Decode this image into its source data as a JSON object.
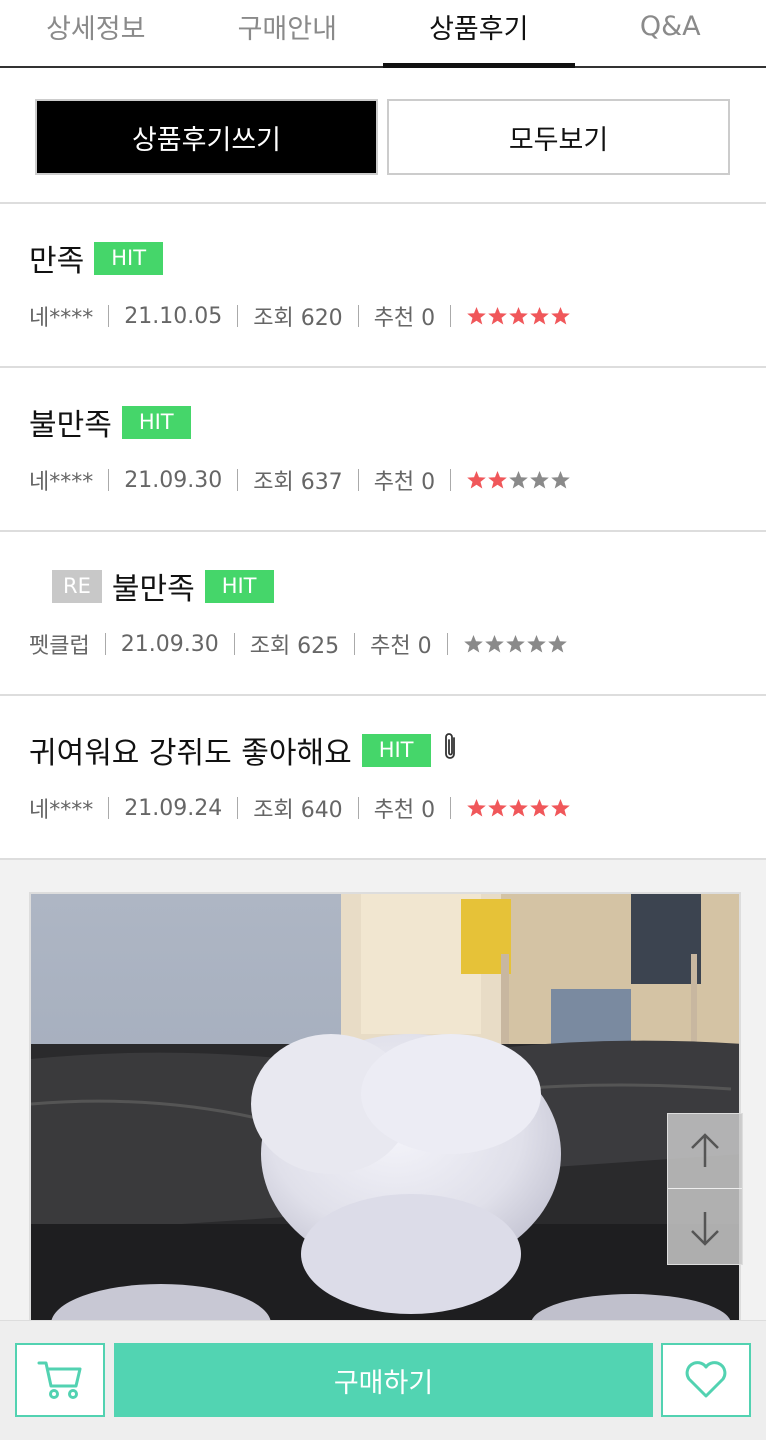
{
  "tabs": [
    {
      "label": "상세정보",
      "active": false
    },
    {
      "label": "구매안내",
      "active": false
    },
    {
      "label": "상품후기",
      "active": true
    },
    {
      "label": "Q&A",
      "active": false
    }
  ],
  "actions": {
    "write_label": "상품후기쓰기",
    "all_label": "모두보기"
  },
  "reviews": [
    {
      "title": "만족",
      "badge": "HIT",
      "author": "네****",
      "date": "21.10.05",
      "views": "조회 620",
      "recommend": "추천 0",
      "rating": 5,
      "is_reply": false,
      "has_attachment": false
    },
    {
      "title": "불만족",
      "badge": "HIT",
      "author": "네****",
      "date": "21.09.30",
      "views": "조회 637",
      "recommend": "추천 0",
      "rating": 2,
      "is_reply": false,
      "has_attachment": false
    },
    {
      "title": "불만족",
      "badge": "HIT",
      "reply_badge": "RE",
      "author": "펫클럽",
      "date": "21.09.30",
      "views": "조회 625",
      "recommend": "추천 0",
      "rating": 0,
      "is_reply": true,
      "has_attachment": false
    },
    {
      "title": "귀여워요 강쥐도 좋아해요",
      "badge": "HIT",
      "author": "네****",
      "date": "21.09.24",
      "views": "조회 640",
      "recommend": "추천 0",
      "rating": 5,
      "is_reply": false,
      "has_attachment": true
    }
  ],
  "colors": {
    "star_on": "#f0575a",
    "star_off": "#8a8a8a",
    "hit": "#45d66a",
    "accent": "#52d4b2"
  },
  "bottom_bar": {
    "buy_label": "구매하기",
    "cart_icon": "cart-icon",
    "wish_icon": "heart-icon"
  }
}
